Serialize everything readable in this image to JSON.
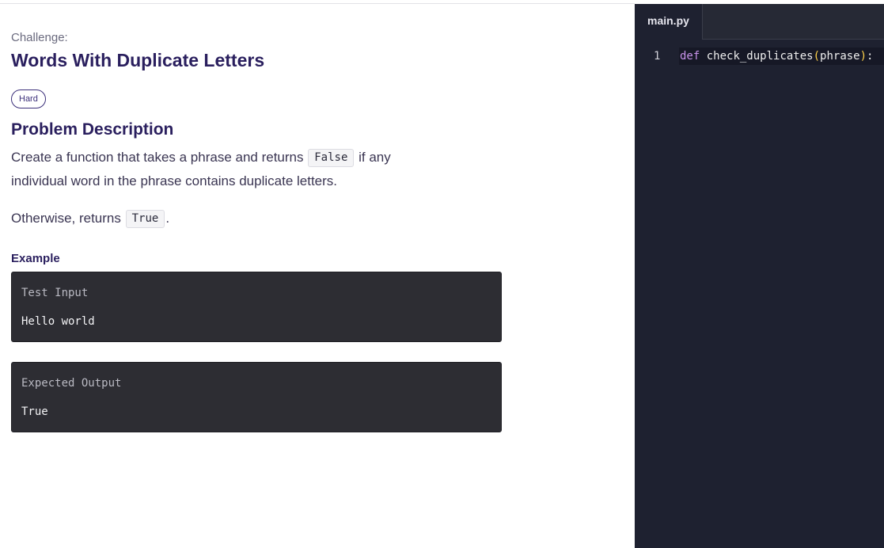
{
  "challenge": {
    "label": "Challenge:",
    "title": "Words With Duplicate Letters",
    "difficulty": "Hard"
  },
  "description": {
    "heading": "Problem Description",
    "line1_before": "Create a function that takes a phrase and returns ",
    "line1_code": "False",
    "line1_after": " if any",
    "line2": "individual word in the phrase contains duplicate letters.",
    "line3_before": "Otherwise, returns ",
    "line3_code": "True",
    "line3_after": "."
  },
  "example": {
    "heading": "Example",
    "input_label": "Test Input",
    "input_value": "Hello world",
    "output_label": "Expected Output",
    "output_value": "True"
  },
  "editor": {
    "tab_label": "main.py",
    "lines": [
      {
        "number": "1",
        "keyword": "def",
        "function_name": "check_duplicates",
        "open_paren": "(",
        "param": "phrase",
        "close_paren": ")",
        "colon": ":"
      }
    ],
    "colors": {
      "background": "#1e2130",
      "keyword": "#c792ea",
      "paren": "#ffd24a",
      "text": "#eeeeee"
    }
  },
  "colors": {
    "heading": "#2a1f5e",
    "body_text": "#3a3552",
    "example_box": "#2d2d33"
  }
}
